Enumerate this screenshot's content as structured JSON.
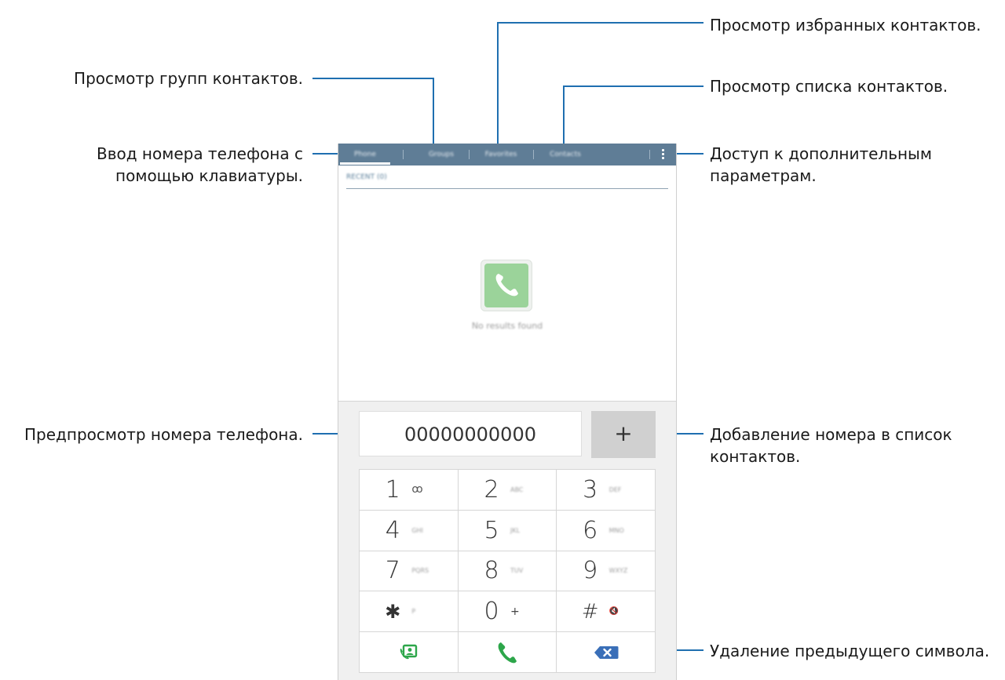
{
  "annotations": {
    "favorites": "Просмотр избранных контактов.",
    "groups": "Просмотр групп контактов.",
    "contacts_list": "Просмотр списка контактов.",
    "keypad_line1": "Ввод номера телефона с",
    "keypad_line2": "помощью клавиатуры.",
    "more_line1": "Доступ к дополнительным",
    "more_line2": "параметрам.",
    "preview": "Предпросмотр номера телефона.",
    "add_line1": "Добавление номера в список",
    "add_line2": "контактов.",
    "delete": "Удаление предыдущего символа."
  },
  "tabs": [
    {
      "label": "Phone"
    },
    {
      "label": "Groups"
    },
    {
      "label": "Favorites"
    },
    {
      "label": "Contacts"
    }
  ],
  "section_label": "RECENT (0)",
  "no_results": "No results found",
  "number_field": {
    "value": "00000000000"
  },
  "add_button": {
    "label": "+"
  },
  "keys": [
    {
      "digit": "1",
      "sub": "ꝏ"
    },
    {
      "digit": "2",
      "sub": "ABC"
    },
    {
      "digit": "3",
      "sub": "DEF"
    },
    {
      "digit": "4",
      "sub": "GHI"
    },
    {
      "digit": "5",
      "sub": "JKL"
    },
    {
      "digit": "6",
      "sub": "MNO"
    },
    {
      "digit": "7",
      "sub": "PQRS"
    },
    {
      "digit": "8",
      "sub": "TUV"
    },
    {
      "digit": "9",
      "sub": "WXYZ"
    },
    {
      "digit": "✱",
      "sub": "P"
    },
    {
      "digit": "0",
      "sub": "+"
    },
    {
      "digit": "#",
      "sub": "🔇"
    }
  ],
  "colors": {
    "tab_bar": "#5f7d96",
    "callout_line": "#1f6fb0",
    "call_green": "#2da64a",
    "delete_blue": "#3a6fb8"
  },
  "icons": {
    "more": "vertical-dots-icon",
    "no_results": "phone-handset-icon",
    "add_contact": "add-to-contacts-icon",
    "call": "call-icon",
    "delete": "backspace-icon"
  }
}
